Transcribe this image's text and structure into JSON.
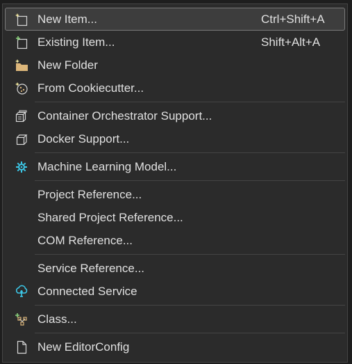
{
  "menu": {
    "groups": [
      {
        "items": [
          {
            "label": "New Item...",
            "shortcut": "Ctrl+Shift+A",
            "icon": "new-item-icon",
            "selected": true
          },
          {
            "label": "Existing Item...",
            "shortcut": "Shift+Alt+A",
            "icon": "existing-item-icon"
          },
          {
            "label": "New Folder",
            "shortcut": "",
            "icon": "new-folder-icon"
          },
          {
            "label": "From Cookiecutter...",
            "shortcut": "",
            "icon": "cookiecutter-icon"
          }
        ]
      },
      {
        "items": [
          {
            "label": "Container Orchestrator Support...",
            "shortcut": "",
            "icon": "container-orchestrator-icon"
          },
          {
            "label": "Docker Support...",
            "shortcut": "",
            "icon": "docker-icon"
          }
        ]
      },
      {
        "items": [
          {
            "label": "Machine Learning Model...",
            "shortcut": "",
            "icon": "machine-learning-icon"
          }
        ]
      },
      {
        "items": [
          {
            "label": "Project Reference...",
            "shortcut": ""
          },
          {
            "label": "Shared Project Reference...",
            "shortcut": ""
          },
          {
            "label": "COM Reference...",
            "shortcut": ""
          }
        ]
      },
      {
        "items": [
          {
            "label": "Service Reference...",
            "shortcut": ""
          },
          {
            "label": "Connected Service",
            "shortcut": "",
            "icon": "connected-service-icon"
          }
        ]
      },
      {
        "items": [
          {
            "label": "Class...",
            "shortcut": "",
            "icon": "class-icon"
          }
        ]
      },
      {
        "items": [
          {
            "label": "New EditorConfig",
            "shortcut": "",
            "icon": "editorconfig-file-icon"
          }
        ]
      }
    ]
  },
  "colors": {
    "menu_bg": "#2b2b2b",
    "selected_bg": "#3d3d3d",
    "text": "#e0e0e0",
    "separator": "#454545",
    "folder": "#dcb67a",
    "accent_cyan": "#3cc8e8",
    "accent_green": "#8bd17c",
    "sparkle": "#f0e6a0"
  }
}
